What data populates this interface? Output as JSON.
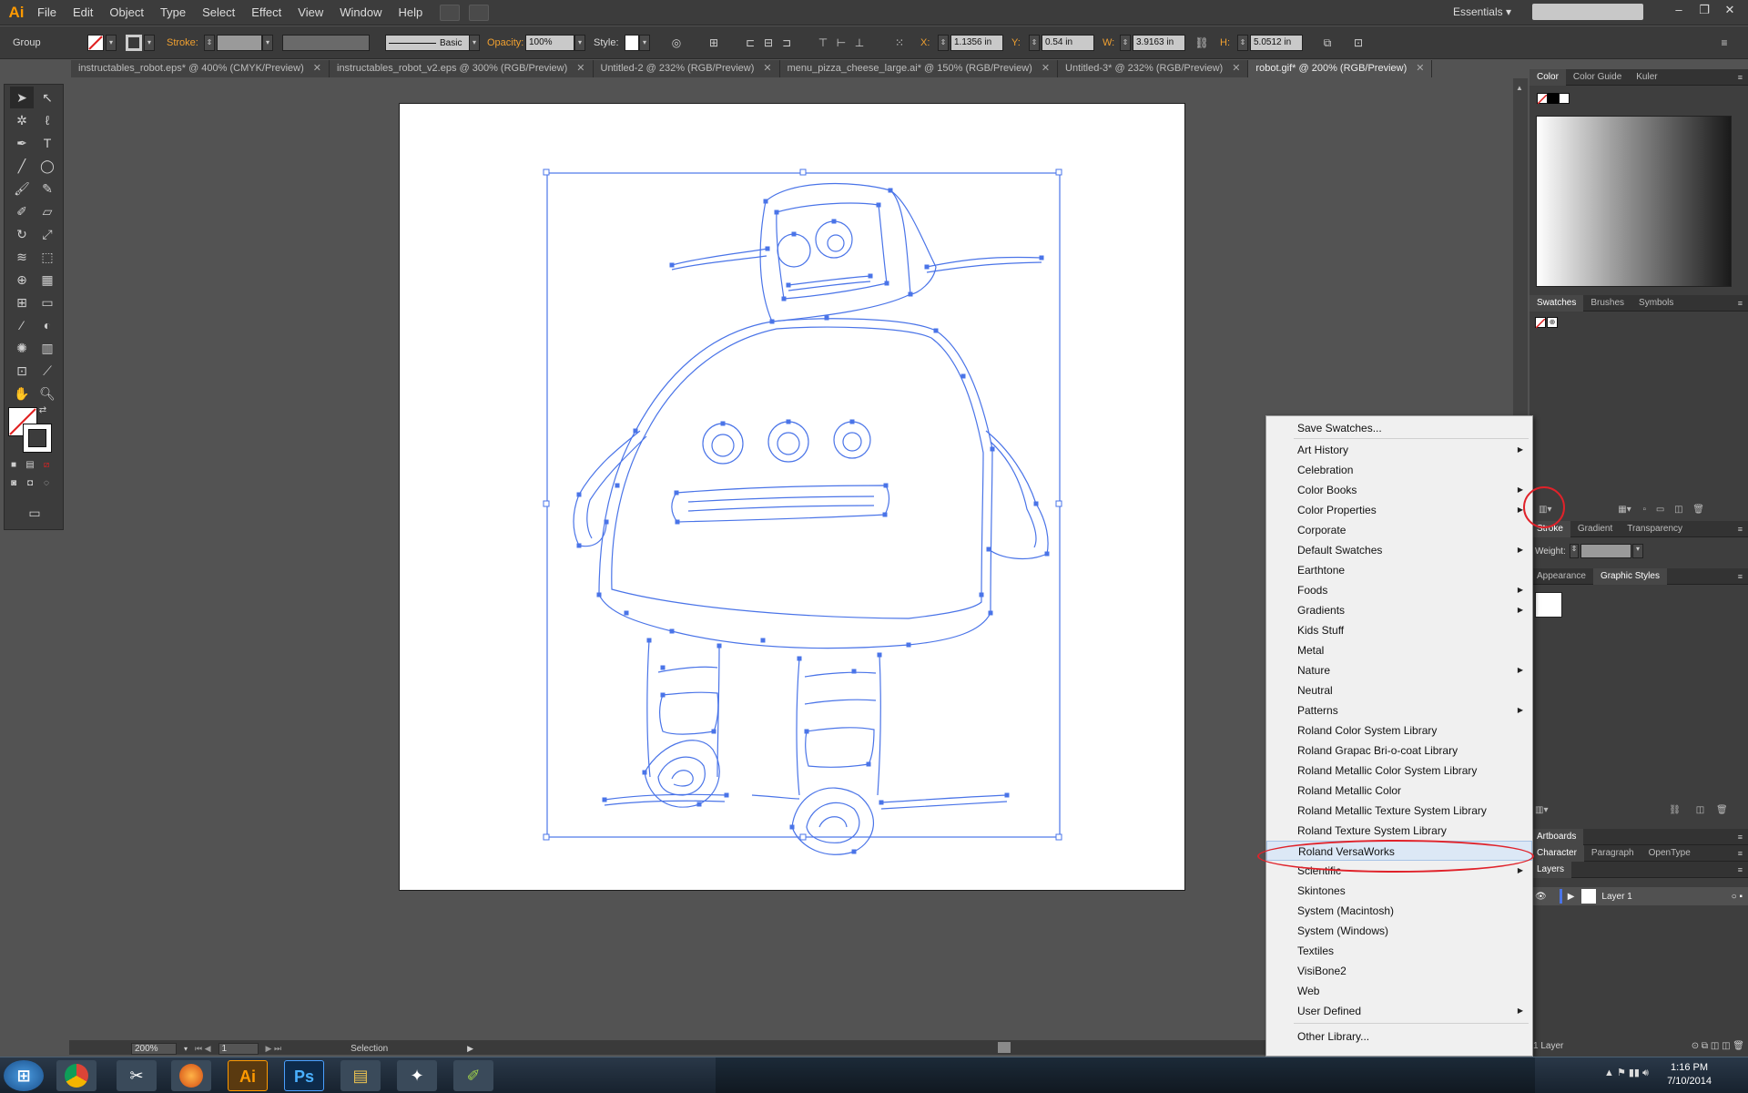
{
  "app": {
    "logo": "Ai"
  },
  "menubar": {
    "items": [
      "File",
      "Edit",
      "Object",
      "Type",
      "Select",
      "Effect",
      "View",
      "Window",
      "Help"
    ],
    "workspace": "Essentials"
  },
  "controlbar": {
    "selection_type": "Group",
    "stroke_label": "Stroke:",
    "brush_label": "Basic",
    "opacity_label": "Opacity:",
    "opacity_value": "100%",
    "style_label": "Style:",
    "x_label": "X:",
    "x_value": "1.1356 in",
    "y_label": "Y:",
    "y_value": "0.54 in",
    "w_label": "W:",
    "w_value": "3.9163 in",
    "h_label": "H:",
    "h_value": "5.0512 in"
  },
  "tabs": [
    {
      "label": "instructables_robot.eps* @ 400% (CMYK/Preview)",
      "active": false
    },
    {
      "label": "instructables_robot_v2.eps @ 300% (RGB/Preview)",
      "active": false
    },
    {
      "label": "Untitled-2 @ 232% (RGB/Preview)",
      "active": false
    },
    {
      "label": "menu_pizza_cheese_large.ai* @ 150% (RGB/Preview)",
      "active": false
    },
    {
      "label": "Untitled-3* @ 232% (RGB/Preview)",
      "active": false
    },
    {
      "label": "robot.gif* @ 200% (RGB/Preview)",
      "active": true
    }
  ],
  "statusbar": {
    "zoom": "200%",
    "artboard": "1",
    "tool": "Selection"
  },
  "panels": {
    "color_tabs": [
      "Color",
      "Color Guide",
      "Kuler"
    ],
    "swatch_tabs": [
      "Swatches",
      "Brushes",
      "Symbols"
    ],
    "stroke_tabs": [
      "Stroke",
      "Gradient",
      "Transparency"
    ],
    "weight_label": "Weight:",
    "appearance_tabs": [
      "Appearance",
      "Graphic Styles"
    ],
    "artboards_tab": "Artboards",
    "type_tabs": [
      "Character",
      "Paragraph",
      "OpenType"
    ],
    "layers_tab": "Layers",
    "layer_name": "Layer 1",
    "layer_count": "1 Layer"
  },
  "flyout": {
    "items": [
      {
        "label": "Save Swatches...",
        "submenu": false
      },
      {
        "label": "Art History",
        "submenu": true
      },
      {
        "label": "Celebration",
        "submenu": false
      },
      {
        "label": "Color Books",
        "submenu": true
      },
      {
        "label": "Color Properties",
        "submenu": true
      },
      {
        "label": "Corporate",
        "submenu": false
      },
      {
        "label": "Default Swatches",
        "submenu": true
      },
      {
        "label": "Earthtone",
        "submenu": false
      },
      {
        "label": "Foods",
        "submenu": true
      },
      {
        "label": "Gradients",
        "submenu": true
      },
      {
        "label": "Kids Stuff",
        "submenu": false
      },
      {
        "label": "Metal",
        "submenu": false
      },
      {
        "label": "Nature",
        "submenu": true
      },
      {
        "label": "Neutral",
        "submenu": false
      },
      {
        "label": "Patterns",
        "submenu": true
      },
      {
        "label": "Roland Color System Library",
        "submenu": false
      },
      {
        "label": "Roland Grapac Bri-o-coat Library",
        "submenu": false
      },
      {
        "label": "Roland Metallic Color System Library",
        "submenu": false
      },
      {
        "label": "Roland Metallic Color",
        "submenu": false
      },
      {
        "label": "Roland Metallic Texture System Library",
        "submenu": false
      },
      {
        "label": "Roland Texture System Library",
        "submenu": false
      },
      {
        "label": "Roland VersaWorks",
        "submenu": false,
        "highlighted": true
      },
      {
        "label": "Scientific",
        "submenu": true
      },
      {
        "label": "Skintones",
        "submenu": false
      },
      {
        "label": "System (Macintosh)",
        "submenu": false
      },
      {
        "label": "System (Windows)",
        "submenu": false
      },
      {
        "label": "Textiles",
        "submenu": false
      },
      {
        "label": "VisiBone2",
        "submenu": false
      },
      {
        "label": "Web",
        "submenu": false
      },
      {
        "label": "User Defined",
        "submenu": true
      },
      {
        "label": "Other Library...",
        "submenu": false
      }
    ]
  },
  "taskbar": {
    "icons": [
      "windows-start-icon",
      "chrome-icon",
      "scissors-icon",
      "firefox-icon",
      "illustrator-icon",
      "photoshop-icon",
      "explorer-icon",
      "app-icon",
      "app2-icon"
    ],
    "time": "1:16 PM",
    "date": "7/10/2014"
  },
  "colors": {
    "selection_blue": "#4a74e8",
    "annotation_red": "#e0222a",
    "illustrator_orange": "#ff9a00"
  }
}
